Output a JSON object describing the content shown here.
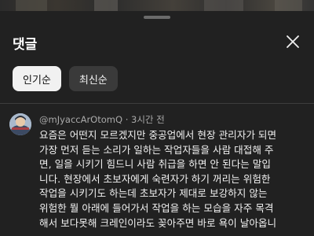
{
  "panel": {
    "title": "댓글"
  },
  "sort_tabs": [
    {
      "label": "인기순",
      "active": true
    },
    {
      "label": "최신순",
      "active": false
    }
  ],
  "comment": {
    "author": "@mJyaccArOtomQ",
    "separator": "·",
    "time": "3시간 전",
    "lines": [
      "요즘은 어떤지 모르겠지만 중공업에서 현장 관리자가 되면",
      "가장 먼저 듣는 소리가 일하는 작업자들을 사람 대접해 주",
      "면, 일을 시키기 힘드니 사람 취급을 하면 안 된다는 말입",
      "니다. 현장에서 초보자에게 숙련자가 하기 꺼리는 위험한",
      "작업을 시키기도 하는데 초보자가 제대로 보강하지 않는",
      "위험한 뭘 아래에 들어가서 작업을 하는 모습을 자주 목격",
      "해서 보다못해 크레인이라도 꽂아주면 바로 욕이 날아옵니"
    ]
  },
  "icons": {
    "close": "close-icon",
    "avatar": "avatar-image"
  },
  "colors": {
    "background": "#212121",
    "active_chip": "#f1f1f1",
    "inactive_chip": "#3a3a3a",
    "meta_text": "#aaaaaa"
  }
}
